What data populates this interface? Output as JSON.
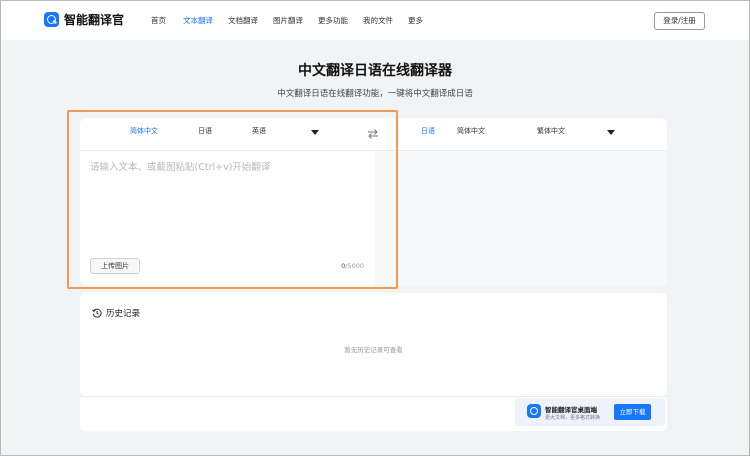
{
  "header": {
    "logo_text": "智能翻译官",
    "nav": [
      {
        "label": "首页",
        "active": false
      },
      {
        "label": "文本翻译",
        "active": true
      },
      {
        "label": "文档翻译",
        "active": false
      },
      {
        "label": "图片翻译",
        "active": false
      },
      {
        "label": "更多功能",
        "active": false
      },
      {
        "label": "我的文件",
        "active": false
      },
      {
        "label": "更多",
        "active": false
      }
    ],
    "login_label": "登录/注册"
  },
  "hero": {
    "title": "中文翻译日语在线翻译器",
    "subtitle": "中文翻译日语在线翻译功能，一键将中文翻译成日语"
  },
  "translator": {
    "source_langs": [
      {
        "label": "简体中文",
        "active": true
      },
      {
        "label": "日语",
        "active": false
      },
      {
        "label": "英语",
        "active": false
      }
    ],
    "target_langs": [
      {
        "label": "日语",
        "active": true
      },
      {
        "label": "简体中文",
        "active": false
      },
      {
        "label": "繁体中文",
        "active": false
      }
    ],
    "placeholder": "请输入文本、或截图粘贴(Ctrl+v)开始翻译",
    "upload_label": "上传图片",
    "char_count": "0",
    "char_max": "/5000"
  },
  "history": {
    "title": "历史记录",
    "empty_text": "暂无历史记录可查看"
  },
  "promo": {
    "title": "智能翻译官桌面端",
    "subtitle": "更大文档，更多格式转换",
    "button_label": "立即下载"
  },
  "colors": {
    "accent": "#1677ff",
    "highlight": "#f29a54",
    "background": "#f2f3f5"
  }
}
